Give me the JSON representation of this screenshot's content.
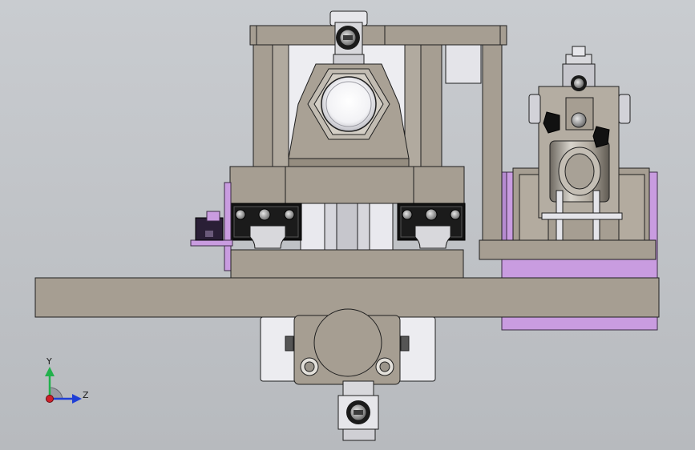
{
  "viewport": {
    "background": "#c0c3c7",
    "part_fill": "#a69e92",
    "part_stroke": "#1f1f1f",
    "highlight_part": "#c99ce0",
    "block_fill": "#e9e9ee"
  },
  "triad": {
    "y_label": "Y",
    "z_label": "Z",
    "y_color": "#22b14c",
    "z_color": "#1f3fd6",
    "origin_color": "#d0202a"
  }
}
